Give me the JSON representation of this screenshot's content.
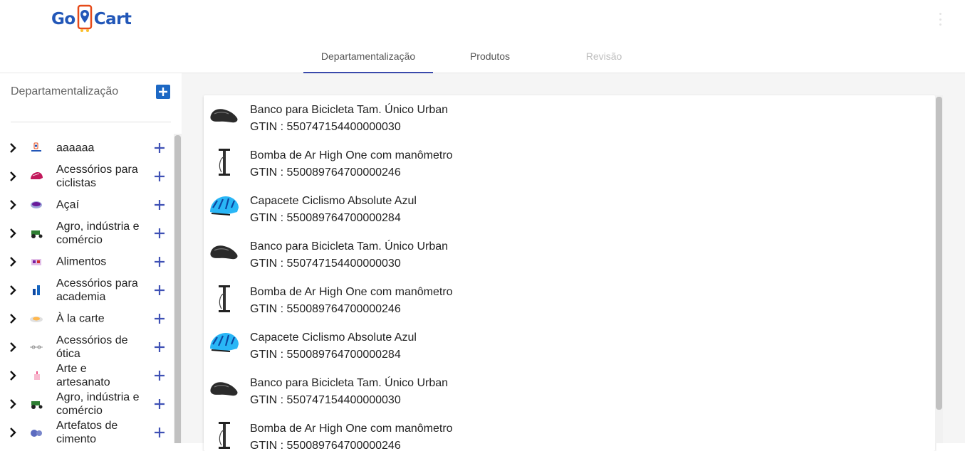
{
  "app": {
    "logo_left": "Go",
    "logo_right": "Cart",
    "brand_color": "#2257b8"
  },
  "tabs": [
    {
      "label": "Departamentalização",
      "state": "active"
    },
    {
      "label": "Produtos",
      "state": "normal"
    },
    {
      "label": "Revisão",
      "state": "disabled"
    }
  ],
  "sidebar": {
    "title": "Departamentalização",
    "items": [
      {
        "label": "aaaaaa",
        "icon": "gocart-logo-thumb"
      },
      {
        "label": "Acessórios para ciclistas",
        "icon": "helmet-thumb"
      },
      {
        "label": "Açaí",
        "icon": "acai-bowl-thumb"
      },
      {
        "label": "Agro, indústria e comércio",
        "icon": "tractor-thumb"
      },
      {
        "label": "Alimentos",
        "icon": "food-thumb"
      },
      {
        "label": "Acessórios para academia",
        "icon": "dumbbell-thumb"
      },
      {
        "label": "À la carte",
        "icon": "plate-thumb"
      },
      {
        "label": "Acessórios de ótica",
        "icon": "glasses-thumb"
      },
      {
        "label": "Arte e artesanato",
        "icon": "craft-thumb"
      },
      {
        "label": "Agro, indústria e comércio",
        "icon": "tractor-thumb"
      },
      {
        "label": "Artefatos de cimento",
        "icon": "cement-thumb"
      }
    ]
  },
  "products": [
    {
      "name": "Banco para Bicicleta Tam. Único Urban",
      "gtin": "GTIN : 550747154400000030",
      "icon": "bike-seat-icon"
    },
    {
      "name": "Bomba de Ar High One com manômetro",
      "gtin": "GTIN : 550089764700000246",
      "icon": "air-pump-icon"
    },
    {
      "name": "Capacete Ciclismo Absolute Azul",
      "gtin": "GTIN : 550089764700000284",
      "icon": "helmet-icon"
    },
    {
      "name": "Banco para Bicicleta Tam. Único Urban",
      "gtin": "GTIN : 550747154400000030",
      "icon": "bike-seat-icon"
    },
    {
      "name": "Bomba de Ar High One com manômetro",
      "gtin": "GTIN : 550089764700000246",
      "icon": "air-pump-icon"
    },
    {
      "name": "Capacete Ciclismo Absolute Azul",
      "gtin": "GTIN : 550089764700000284",
      "icon": "helmet-icon"
    },
    {
      "name": "Banco para Bicicleta Tam. Único Urban",
      "gtin": "GTIN : 550747154400000030",
      "icon": "bike-seat-icon"
    },
    {
      "name": "Bomba de Ar High One com manômetro",
      "gtin": "GTIN : 550089764700000246",
      "icon": "air-pump-icon"
    }
  ],
  "colors": {
    "accent": "#3949ab",
    "add_button": "#1d68c4",
    "plus": "#3f51b5"
  }
}
